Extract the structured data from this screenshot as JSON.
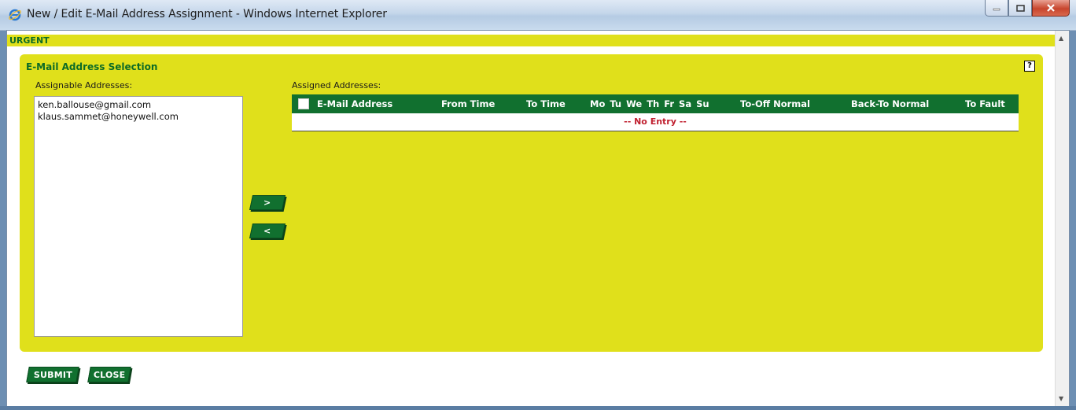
{
  "window": {
    "title": "New / Edit E-Mail Address Assignment - Windows Internet Explorer"
  },
  "banner": {
    "text": "URGENT"
  },
  "panel": {
    "title": "E-Mail Address Selection",
    "help": "?"
  },
  "assignable": {
    "label": "Assignable Addresses:",
    "items": [
      "ken.ballouse@gmail.com",
      "klaus.sammet@honeywell.com"
    ]
  },
  "move": {
    "add": ">",
    "remove": "<"
  },
  "assigned": {
    "label": "Assigned Addresses:",
    "columns": {
      "email": "E-Mail Address",
      "from": "From Time",
      "to": "To Time",
      "days": "Mo  Tu  We  Th  Fr  Sa  Su",
      "off_normal": "To-Off Normal",
      "back_normal": "Back-To Normal",
      "fault": "To Fault"
    },
    "empty_text": "-- No Entry --"
  },
  "actions": {
    "submit": "SUBMIT",
    "close": "CLOSE"
  },
  "colors": {
    "panel": "#e0e01b",
    "accent": "#11702f",
    "heading": "#0d6b26",
    "empty": "#c0202f"
  }
}
